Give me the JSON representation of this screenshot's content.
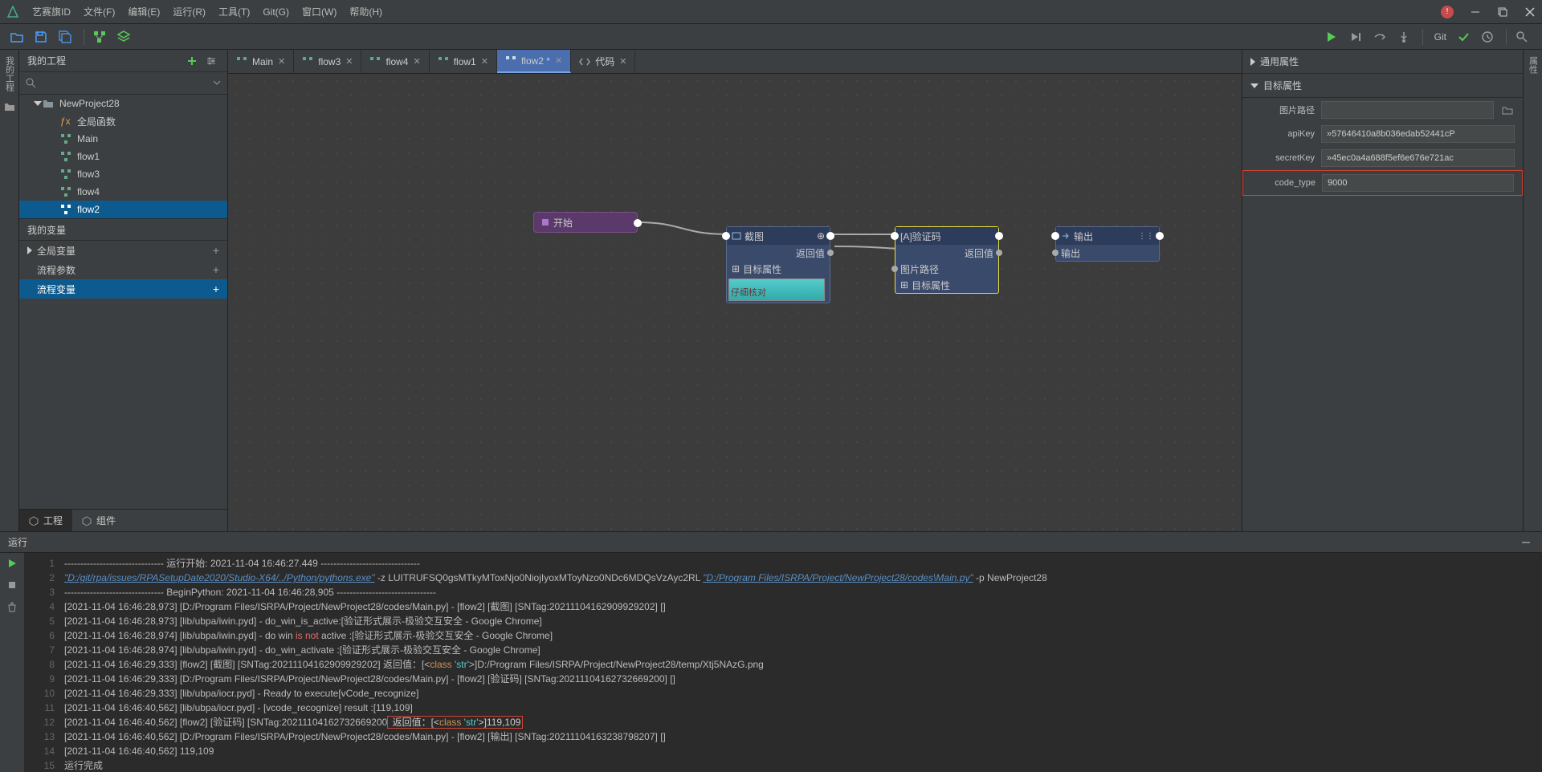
{
  "titlebar": {
    "app": "艺赛旗ID",
    "menus": [
      "文件(F)",
      "编辑(E)",
      "运行(R)",
      "工具(T)",
      "Git(G)",
      "窗口(W)",
      "帮助(H)"
    ]
  },
  "toolbar_right": {
    "git": "Git"
  },
  "left_rail": {
    "label": "我的工程"
  },
  "project": {
    "header": "我的工程",
    "root": "NewProject28",
    "items": [
      "全局函数",
      "Main",
      "flow1",
      "flow3",
      "flow4",
      "flow2"
    ],
    "selected": "flow2",
    "vars_header": "我的变量",
    "var_rows": [
      "全局变量",
      "流程参数",
      "流程变量"
    ],
    "var_selected": "流程变量",
    "tabs": {
      "project": "工程",
      "components": "组件"
    }
  },
  "tabs": [
    {
      "label": "Main",
      "active": false
    },
    {
      "label": "flow3",
      "active": false
    },
    {
      "label": "flow4",
      "active": false
    },
    {
      "label": "flow1",
      "active": false
    },
    {
      "label": "flow2 *",
      "active": true
    },
    {
      "label": "代码",
      "active": false
    }
  ],
  "canvas": {
    "start": "开始",
    "node1": {
      "title": "截图",
      "out": "返回值",
      "attr": "目标属性"
    },
    "node2": {
      "title": "[A]验证码",
      "out": "返回值",
      "in1": "图片路径",
      "in2": "目标属性"
    },
    "node3": {
      "title": "输出",
      "in": "输出"
    }
  },
  "props": {
    "section1": "通用属性",
    "section2": "目标属性",
    "rows": [
      {
        "label": "图片路径",
        "value": ""
      },
      {
        "label": "apiKey",
        "value": "»57646410a8b036edab52441cP"
      },
      {
        "label": "secretKey",
        "value": "»45ec0a4a688f5ef6e676e721ac"
      },
      {
        "label": "code_type",
        "value": "9000"
      }
    ]
  },
  "right_rail": {
    "label": "属性"
  },
  "console": {
    "header": "运行",
    "lines": [
      {
        "n": 1,
        "html": "------------------------------- 运行开始: 2021-11-04 16:46:27.449 -------------------------------"
      },
      {
        "n": 2,
        "html": "<span class='link'>\"D:/git/rpa/issues/RPASetupDate2020/Studio-X64/../Python/pythons.exe\"</span>   -z LUITRUFSQ0gsMTkyMToxNjo0NiojIyoxMToyNzo0NDc6MDQsVzAyc2RL <span class='link'>\"D:/Program Files/ISRPA/Project/NewProject28/codes\\Main.py\"</span>  -p  NewProject28"
      },
      {
        "n": 3,
        "html": "------------------------------- BeginPython: 2021-11-04 16:46:28,905 -------------------------------"
      },
      {
        "n": 4,
        "html": "[2021-11-04 16:46:28,973] [D:/Program Files/ISRPA/Project/NewProject28/codes/Main.py] - [flow2] [截图] [SNTag:20211104162909929202] []"
      },
      {
        "n": 5,
        "html": "[2021-11-04 16:46:28,973] [lib/ubpa/iwin.pyd] - do_win_is_active:[验证形式展示-极验交互安全 - Google Chrome]"
      },
      {
        "n": 6,
        "html": "[2021-11-04 16:46:28,974] [lib/ubpa/iwin.pyd] - do win <span class='red'>is not</span> active :[验证形式展示-极验交互安全 - Google Chrome]"
      },
      {
        "n": 7,
        "html": "[2021-11-04 16:46:28,974] [lib/ubpa/iwin.pyd] - do_win_activate :[验证形式展示-极验交互安全 - Google Chrome]"
      },
      {
        "n": 8,
        "html": "[2021-11-04 16:46:29,333] [flow2] [截图] [SNTag:20211104162909929202]  返回值：[&lt;<span class='orange'>class </span><span class='cyan'>'str'</span>&gt;]D:/Program Files/ISRPA/Project/NewProject28/temp/Xtj5NAzG.png"
      },
      {
        "n": 9,
        "html": "[2021-11-04 16:46:29,333] [D:/Program Files/ISRPA/Project/NewProject28/codes/Main.py] - [flow2] [验证码] [SNTag:20211104162732669200] []"
      },
      {
        "n": 10,
        "html": "[2021-11-04 16:46:29,333] [lib/ubpa/iocr.pyd] - Ready to execute[vCode_recognize]"
      },
      {
        "n": 11,
        "html": "[2021-11-04 16:46:40,562] [lib/ubpa/iocr.pyd] - [vcode_recognize] result :[119,109]"
      },
      {
        "n": 12,
        "html": "[2021-11-04 16:46:40,562] [flow2] [验证码] [SNTag:20211104162732669200<span class='box'>  返回值：[&lt;<span class='orange'>class </span><span class='cyan'>'str'</span>&gt;]119,109  </span>"
      },
      {
        "n": 13,
        "html": "[2021-11-04 16:46:40,562] [D:/Program Files/ISRPA/Project/NewProject28/codes/Main.py] - [flow2] [输出] [SNTag:20211104163238798207] []"
      },
      {
        "n": 14,
        "html": "[2021-11-04 16:46:40,562] 119,109"
      },
      {
        "n": 15,
        "html": "运行完成"
      }
    ]
  }
}
